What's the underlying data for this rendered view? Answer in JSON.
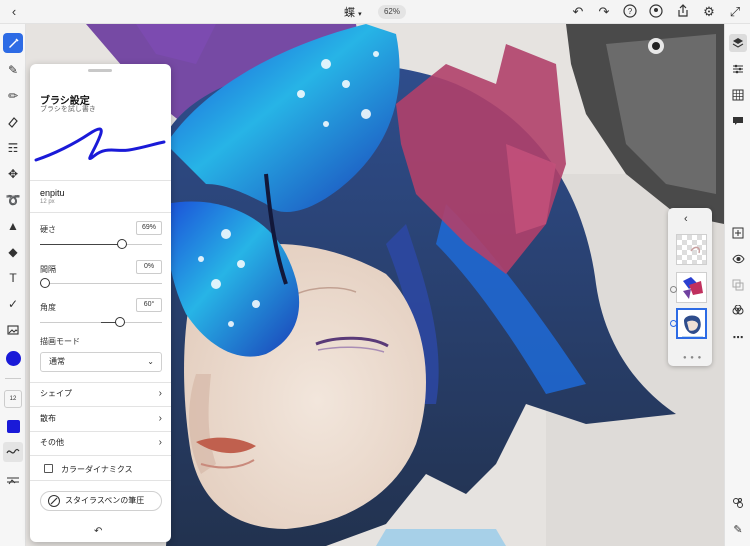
{
  "top_bar": {
    "doc_title": "蝶",
    "zoom": "62%"
  },
  "brush_panel": {
    "title": "ブラシ設定",
    "subtitle": "ブラシを試し書き",
    "brush_name": "enpitu",
    "brush_size": "12 px",
    "hardness": {
      "label": "硬さ",
      "value": "69%",
      "level": 0.69
    },
    "spacing": {
      "label": "間隔",
      "value": "0%",
      "level": 0.0
    },
    "angle": {
      "label": "角度",
      "value": "60°",
      "level": 0.17
    },
    "draw_mode": {
      "label": "描画モード",
      "selected": "通常"
    },
    "rows": [
      {
        "label": "シェイプ"
      },
      {
        "label": "散布"
      },
      {
        "label": "その他"
      }
    ],
    "color_dynamics_label": "カラーダイナミクス",
    "stylus_pressure_label": "スタイラスペンの筆圧"
  },
  "left_toolbar": {
    "size_value": "12",
    "brush_color": "#1a1ad8",
    "accent": "#2d6be5"
  },
  "icons": {
    "top": [
      "back-icon",
      "undo-icon",
      "redo-icon",
      "help-icon",
      "notification-icon",
      "share-icon",
      "gear-icon",
      "fullscreen-icon"
    ],
    "left": [
      "brush-icon",
      "pencil-brush-icon",
      "fill-brush-icon",
      "eraser-icon",
      "smudge-icon",
      "move-icon",
      "lasso-icon",
      "paint-bucket-icon",
      "shape-icon",
      "text-icon",
      "eyedropper-icon",
      "image-icon"
    ],
    "right": [
      "layers-icon",
      "adjust-icon",
      "grid-icon",
      "comment-icon",
      "add-layer-icon",
      "visibility-icon",
      "merge-icon",
      "fx-icon",
      "more-icon"
    ]
  }
}
